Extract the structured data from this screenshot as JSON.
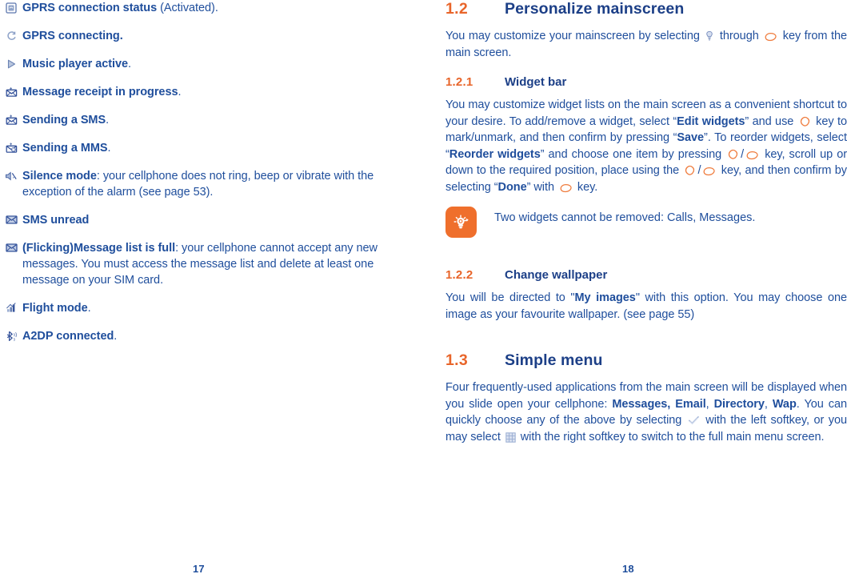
{
  "left_page": {
    "page_number": "17",
    "glossary": [
      {
        "icon": "gprs-connection-status-icon",
        "bold": "GPRS connection status",
        "rest": " (Activated)."
      },
      {
        "icon": "gprs-connecting-icon",
        "bold": "GPRS connecting.",
        "rest": ""
      },
      {
        "icon": "music-player-active-icon",
        "bold": "Music player active",
        "rest": "."
      },
      {
        "icon": "message-receipt-in-progress-icon",
        "bold": "Message receipt in progress",
        "rest": "."
      },
      {
        "icon": "sending-sms-icon",
        "bold": "Sending a SMS",
        "rest": "."
      },
      {
        "icon": "sending-mms-icon",
        "bold": "Sending a MMS",
        "rest": "."
      },
      {
        "icon": "silence-mode-icon",
        "bold": "Silence mode",
        "rest": ": your cellphone does not ring, beep or vibrate with the exception of the alarm (see page 53)."
      },
      {
        "icon": "sms-unread-icon",
        "bold": "SMS unread",
        "rest": ""
      },
      {
        "icon": "message-list-full-icon",
        "bold": "(Flicking)Message list is full",
        "rest": ": your cellphone cannot accept any new messages. You must access the message list and delete at least one message on your SIM card."
      },
      {
        "icon": "flight-mode-icon",
        "bold": "Flight mode",
        "rest": "."
      },
      {
        "icon": "a2dp-connected-icon",
        "bold": "A2DP connected",
        "rest": "."
      }
    ]
  },
  "right_page": {
    "page_number": "18",
    "section_1_2": {
      "number": "1.2",
      "title": "Personalize mainscreen",
      "intro_a": "You may customize your mainscreen by selecting ",
      "intro_b": " through ",
      "intro_c": " key from the main screen."
    },
    "section_1_2_1": {
      "number": "1.2.1",
      "title": "Widget bar",
      "p1_a": "You may customize widget lists on the main screen as a convenient shortcut to your desire. To add/remove a widget, select “",
      "p1_edit": "Edit widgets",
      "p1_b": "” and use ",
      "p1_c": " key to mark/unmark, and then confirm by pressing “",
      "p1_save": "Save",
      "p1_d": "”. To reorder widgets, select “",
      "p1_reorder": "Reorder widgets",
      "p1_e": "” and choose one item by pressing ",
      "p1_f": "/",
      "p1_g": " key, scroll up or down to the required position, place using the ",
      "p1_h": "/",
      "p1_i": " key, and then confirm by selecting “",
      "p1_done": "Done",
      "p1_j": "” with ",
      "p1_k": " key."
    },
    "note": {
      "icon": "tip-bulb-icon",
      "text": "Two widgets cannot be removed: Calls, Messages."
    },
    "section_1_2_2": {
      "number": "1.2.2",
      "title": "Change wallpaper",
      "p1_a": "You will be directed to \"",
      "p1_my_images": "My images",
      "p1_b": "\" with this option. You may choose one image as your favourite wallpaper. (see page 55)"
    },
    "section_1_3": {
      "number": "1.3",
      "title": "Simple menu",
      "p1_a": "Four frequently-used applications from the main screen will be displayed when you slide open your cellphone: ",
      "p1_messages": "Messages, Email",
      "p1_comma1": ", ",
      "p1_directory": "Directory",
      "p1_comma2": ", ",
      "p1_wap": "Wap",
      "p1_b": ". You can quickly choose any of the above by selecting ",
      "p1_c": " with the left softkey, or you may select ",
      "p1_d": " with the right softkey to switch to the full main menu screen."
    }
  },
  "colors": {
    "body_blue": "#1f4e9c",
    "heading_blue": "#1c3f87",
    "accent_orange": "#e8652a",
    "badge_orange": "#ef6f2c",
    "icon_blue": "#5b76ad"
  }
}
